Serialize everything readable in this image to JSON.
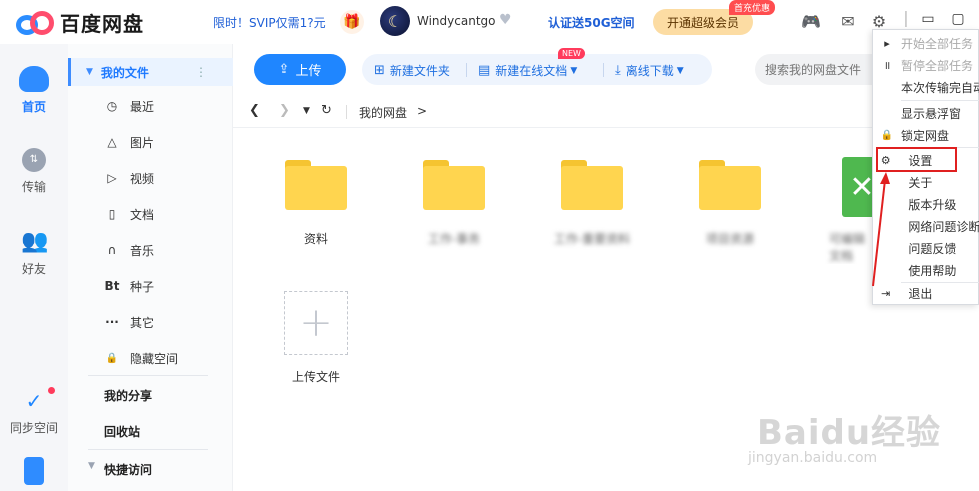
{
  "app": {
    "title": "百度网盘",
    "promo": "限时！SVIP仅需1?元",
    "username": "Windycantgo",
    "verify": "认证送50G空间",
    "vip_button": "开通超级会员",
    "vip_tag": "首充优惠"
  },
  "rail": [
    {
      "label": "首页"
    },
    {
      "label": "传输"
    },
    {
      "label": "好友"
    },
    {
      "label": "同步空间"
    }
  ],
  "sidebar": {
    "my_files": "我的文件",
    "items": [
      {
        "icon": "clock-icon",
        "glyph": "◷",
        "label": "最近"
      },
      {
        "icon": "image-icon",
        "glyph": "△",
        "label": "图片"
      },
      {
        "icon": "video-icon",
        "glyph": "▷",
        "label": "视频"
      },
      {
        "icon": "document-icon",
        "glyph": "▯",
        "label": "文档"
      },
      {
        "icon": "headphones-icon",
        "glyph": "∩",
        "label": "音乐"
      },
      {
        "icon": "torrent-icon",
        "glyph": "Bt",
        "label": "种子"
      },
      {
        "icon": "more-icon",
        "glyph": "···",
        "label": "其它"
      },
      {
        "icon": "lock-icon",
        "glyph": "🔒",
        "label": "隐藏空间"
      }
    ],
    "my_share": "我的分享",
    "recycle": "回收站",
    "quick_access": "快捷访问"
  },
  "toolbar": {
    "upload": "上传",
    "new_folder": "新建文件夹",
    "new_online_doc": "新建在线文档",
    "new_tag": "NEW",
    "offline_download": "离线下载",
    "search_placeholder": "搜索我的网盘文件"
  },
  "breadcrumb": {
    "root": "我的网盘",
    "separator": ">"
  },
  "files": [
    {
      "name": "资料",
      "blurred": false
    },
    {
      "name": "工作-事务",
      "blurred": true
    },
    {
      "name": "工作-重要资料",
      "blurred": true
    },
    {
      "name": "项目资源",
      "blurred": true
    },
    {
      "name": "可编辑文档",
      "blurred": true
    }
  ],
  "upload_tile": "上传文件",
  "menu": {
    "items": [
      {
        "label": "开始全部任务",
        "icon": "play-icon",
        "glyph": "▸",
        "disabled": true
      },
      {
        "label": "暂停全部任务",
        "icon": "pause-icon",
        "glyph": "॥",
        "disabled": true
      },
      {
        "label": "本次传输完自动关机",
        "icon": "",
        "glyph": "",
        "disabled": false
      },
      {
        "label": "显示悬浮窗",
        "icon": "",
        "glyph": "",
        "disabled": false
      },
      {
        "label": "锁定网盘",
        "icon": "lock-icon",
        "glyph": "🔒",
        "disabled": false
      },
      {
        "label": "设置",
        "icon": "gear-icon",
        "glyph": "⚙",
        "disabled": false
      },
      {
        "label": "关于",
        "icon": "",
        "glyph": "",
        "disabled": false
      },
      {
        "label": "版本升级",
        "icon": "",
        "glyph": "",
        "disabled": false
      },
      {
        "label": "网络问题诊断",
        "icon": "",
        "glyph": "",
        "disabled": false
      },
      {
        "label": "问题反馈",
        "icon": "",
        "glyph": "",
        "disabled": false
      },
      {
        "label": "使用帮助",
        "icon": "",
        "glyph": "",
        "disabled": false
      },
      {
        "label": "退出",
        "icon": "exit-icon",
        "glyph": "⇥",
        "disabled": false
      }
    ]
  },
  "watermark": {
    "brand": "Baidu经验",
    "url": "jingyan.baidu.com"
  },
  "colors": {
    "accent": "#1f86ff",
    "highlight": "#e02020",
    "folder": "#ffd54f"
  }
}
